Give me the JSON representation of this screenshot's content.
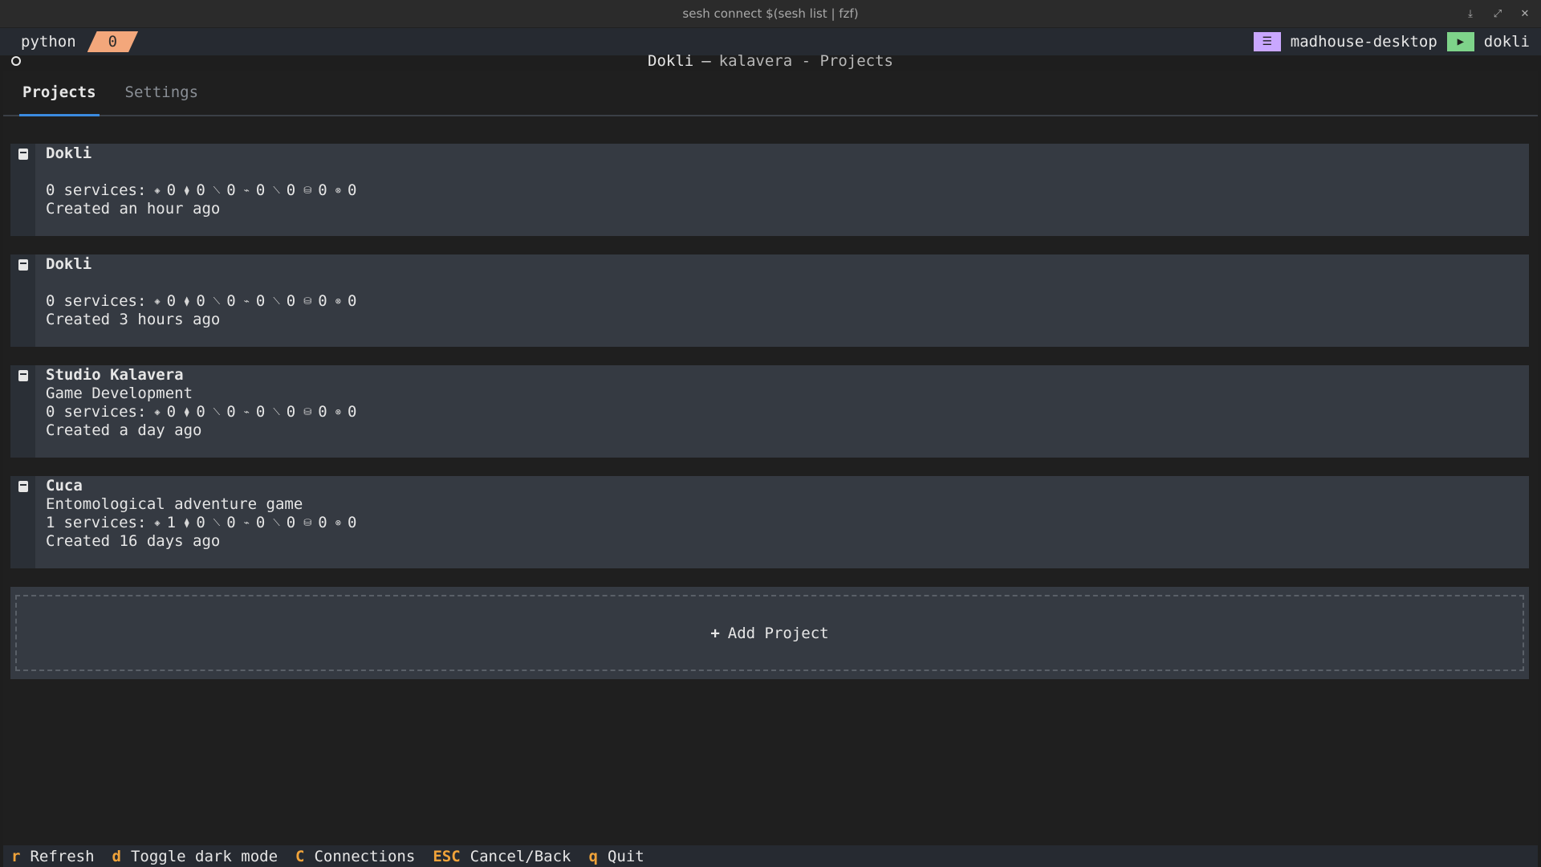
{
  "window": {
    "title": "sesh connect $(sesh list | fzf)",
    "controls": [
      "⤓",
      "⤢",
      "✕"
    ]
  },
  "tmux": {
    "session": "python",
    "window_index": "0",
    "host": "madhouse-desktop",
    "term": "dokli",
    "host_icon": "server-icon",
    "term_icon": "terminal-icon"
  },
  "header": {
    "app": "Dokli",
    "dash": "—",
    "subtitle": "kalavera - Projects"
  },
  "tabs": [
    {
      "label": "Projects",
      "active": true
    },
    {
      "label": "Settings",
      "active": false
    }
  ],
  "services_icons": [
    "◈",
    "⧫",
    "⟍",
    "⌁",
    "⟍",
    "⛁",
    "⊗"
  ],
  "projects": [
    {
      "name": "Dokli",
      "description": "",
      "services_total": "0",
      "counts": [
        "0",
        "0",
        "0",
        "0",
        "0",
        "0",
        "0"
      ],
      "created": "Created an hour ago"
    },
    {
      "name": "Dokli",
      "description": "",
      "services_total": "0",
      "counts": [
        "0",
        "0",
        "0",
        "0",
        "0",
        "0",
        "0"
      ],
      "created": "Created 3 hours ago"
    },
    {
      "name": "Studio Kalavera",
      "description": "Game Development",
      "services_total": "0",
      "counts": [
        "0",
        "0",
        "0",
        "0",
        "0",
        "0",
        "0"
      ],
      "created": "Created a day ago"
    },
    {
      "name": "Cuca",
      "description": "Entomological adventure game",
      "services_total": "1",
      "counts": [
        "1",
        "0",
        "0",
        "0",
        "0",
        "0",
        "0"
      ],
      "created": "Created 16 days ago"
    }
  ],
  "services_label": "services:",
  "add_project": {
    "plus": "+",
    "label": "Add Project"
  },
  "footer": [
    {
      "key": "r",
      "label": "Refresh"
    },
    {
      "key": "d",
      "label": "Toggle dark mode"
    },
    {
      "key": "C",
      "label": "Connections"
    },
    {
      "key": "ESC",
      "label": "Cancel/Back"
    },
    {
      "key": "q",
      "label": "Quit"
    }
  ],
  "colors": {
    "accent": "#3b8be0",
    "key": "#f0a33a",
    "tmux_window": "#f3a77b",
    "host_chip": "#c9a7ff",
    "term_chip": "#7ed38a"
  }
}
